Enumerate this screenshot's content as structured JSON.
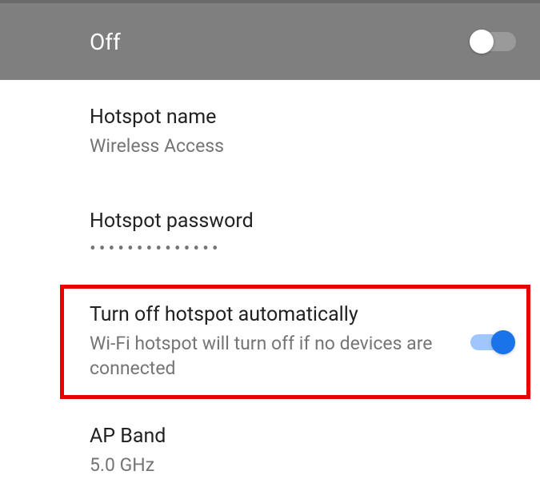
{
  "header": {
    "status_label": "Off",
    "toggle_state": "off"
  },
  "settings": {
    "hotspot_name": {
      "title": "Hotspot name",
      "value": "Wireless Access"
    },
    "hotspot_password": {
      "title": "Hotspot password",
      "value": "••••••••••••••"
    },
    "auto_off": {
      "title": "Turn off hotspot automatically",
      "subtitle": "Wi-Fi hotspot will turn off if no devices are connected",
      "toggle_state": "on"
    },
    "ap_band": {
      "title": "AP Band",
      "value": "5.0 GHz"
    }
  }
}
